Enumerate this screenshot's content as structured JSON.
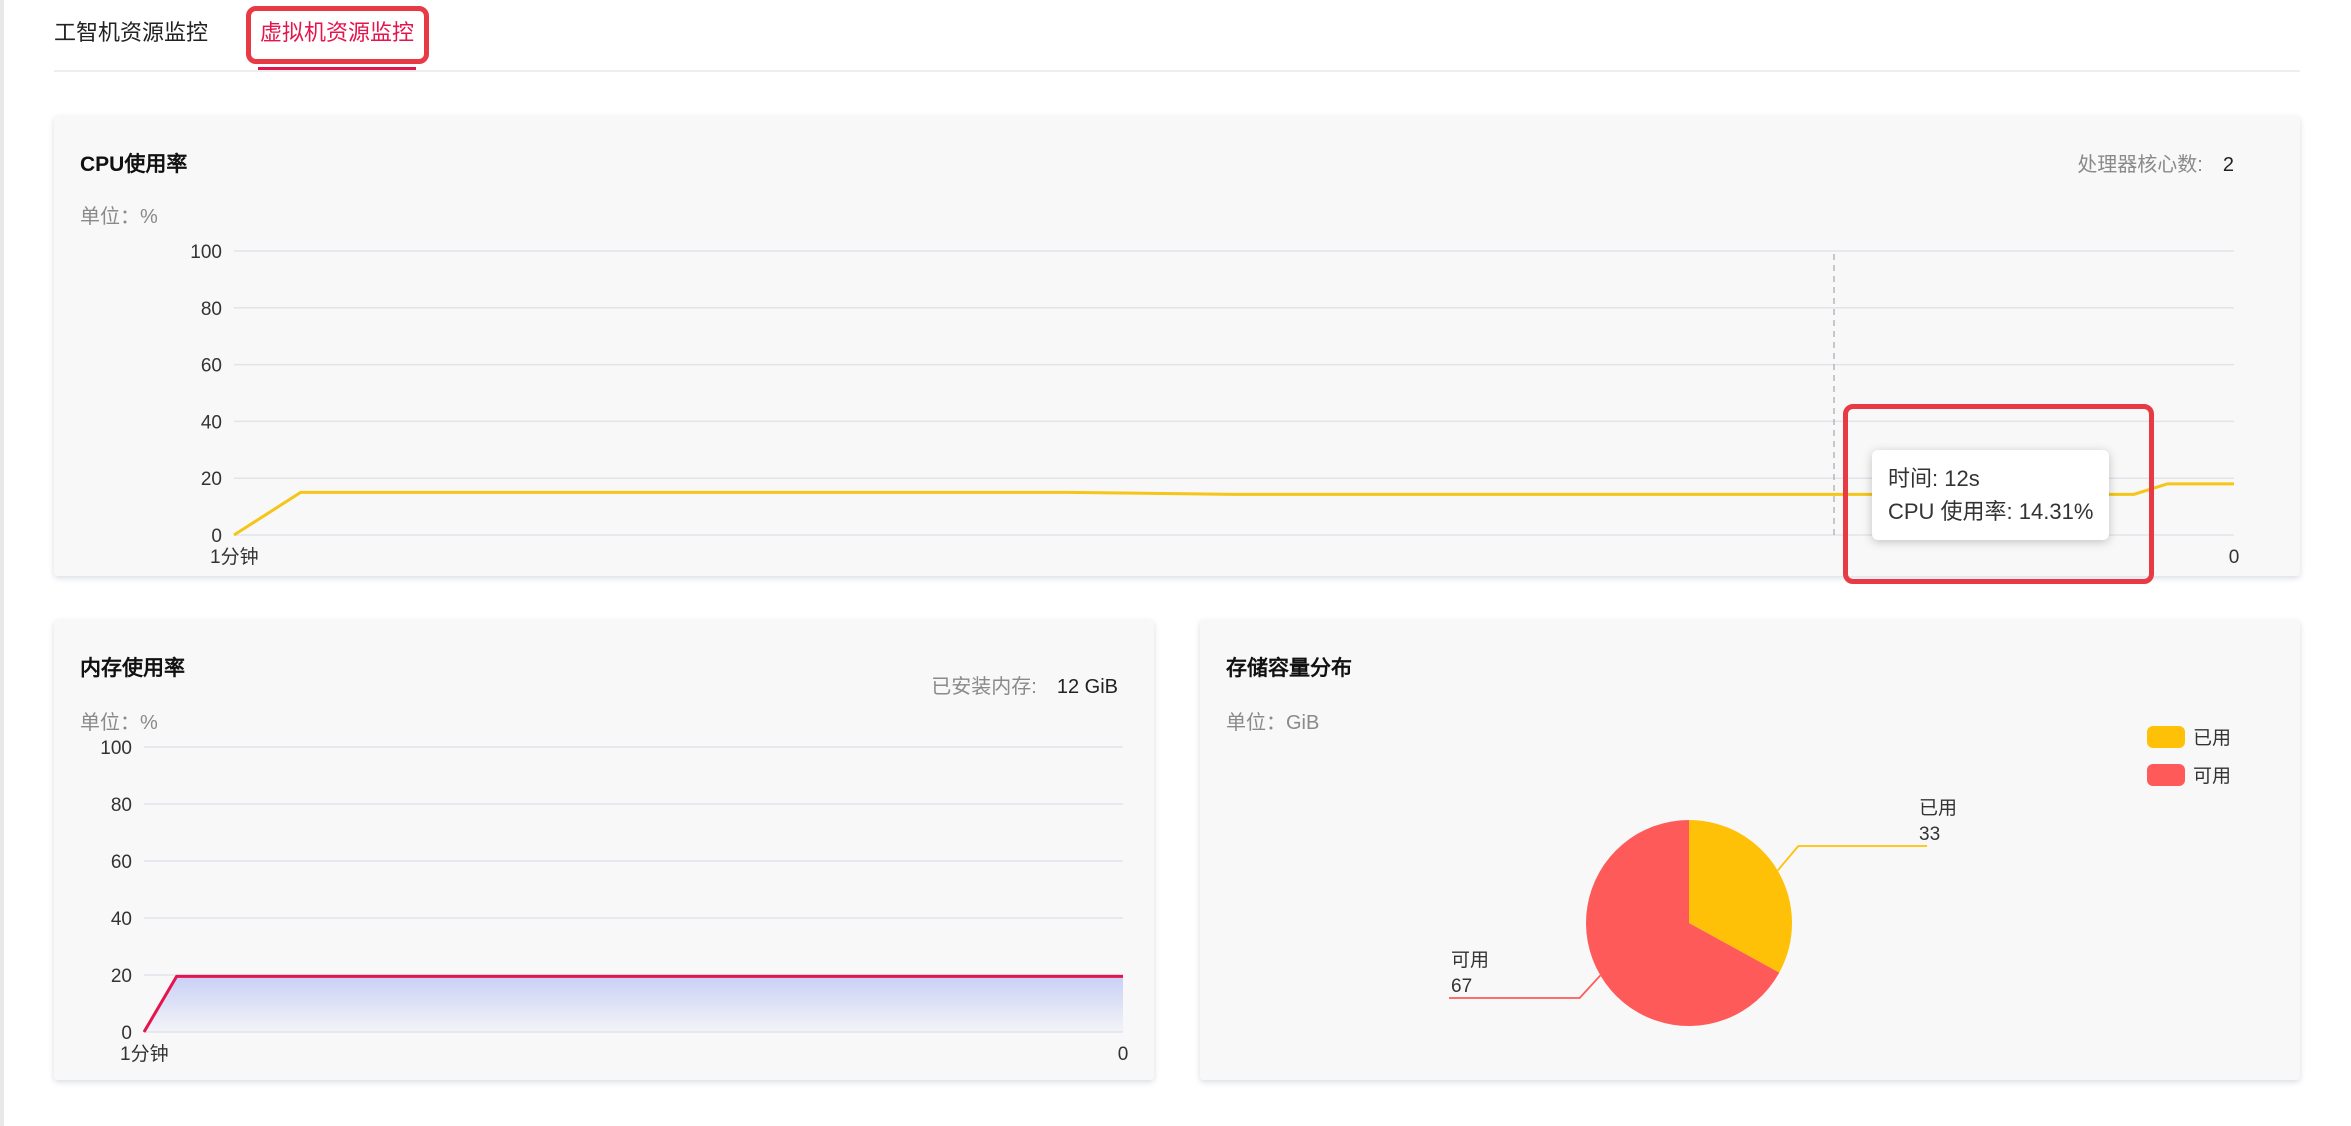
{
  "tabs": [
    {
      "label": "工智机资源监控",
      "active": false
    },
    {
      "label": "虚拟机资源监控",
      "active": true
    }
  ],
  "cpu": {
    "title": "CPU使用率",
    "cores_label": "处理器核心数:",
    "cores_value": "2",
    "unit": "单位：%",
    "chart_data": {
      "type": "line",
      "title": "CPU使用率",
      "xlabel": "",
      "ylabel": "单位：%",
      "ylim": [
        0,
        100
      ],
      "yticks": [
        0,
        20,
        40,
        60,
        80,
        100
      ],
      "x_start_label": "1分钟",
      "x_end_label": "0",
      "x_seconds_ago": [
        60,
        58,
        45,
        35,
        30,
        25,
        20,
        15,
        12,
        8,
        5,
        3,
        2,
        0
      ],
      "values": [
        0,
        15,
        15,
        15,
        14.31,
        14.31,
        14.31,
        14.31,
        14.31,
        14.31,
        14.31,
        14.31,
        18,
        18
      ],
      "line_color": "#f5c518",
      "tooltip": {
        "time_label": "时间: 12s",
        "value_label": "CPU 使用率: 14.31%",
        "time_seconds": 12
      }
    }
  },
  "memory": {
    "title": "内存使用率",
    "installed_label": "已安装内存:",
    "installed_value": "12 GiB",
    "unit": "单位：%",
    "chart_data": {
      "type": "area",
      "title": "内存使用率",
      "ylabel": "单位：%",
      "ylim": [
        0,
        100
      ],
      "yticks": [
        0,
        20,
        40,
        60,
        80,
        100
      ],
      "x_start_label": "1分钟",
      "x_end_label": "0",
      "x_seconds_ago": [
        60,
        58,
        0
      ],
      "values": [
        0,
        19.5,
        19.5
      ],
      "line_color": "#e4144c",
      "fill_color": "#c9d0f5"
    }
  },
  "storage": {
    "title": "存储容量分布",
    "unit": "单位：GiB",
    "chart_data": {
      "type": "pie",
      "title": "存储容量分布",
      "slices": [
        {
          "name": "已用",
          "value": 33,
          "color": "#ffc107"
        },
        {
          "name": "可用",
          "value": 67,
          "color": "#ff5a5a"
        }
      ],
      "legend": "top-right"
    }
  }
}
